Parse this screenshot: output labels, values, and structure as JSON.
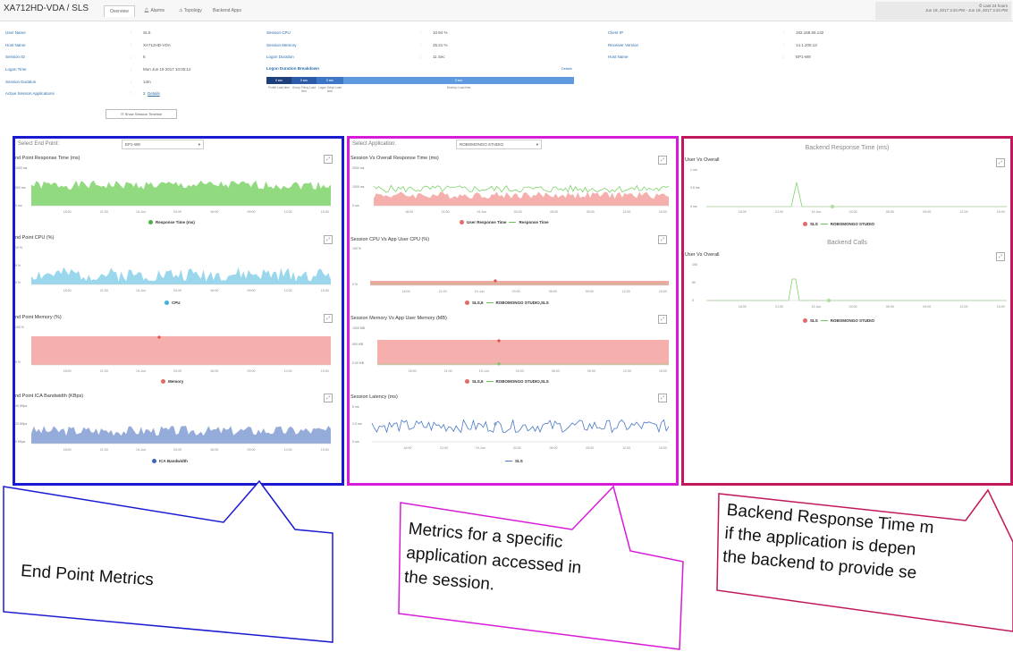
{
  "header": {
    "title": "XA712HD-VDA / SLS",
    "tabs": [
      "Overview",
      "Alarms",
      "Topology",
      "Backend Apps"
    ],
    "range_label": "Last 24 hours",
    "range_detail": "Jun 18, 2017 3:34 PM - Jun 19, 2017 3:34 PM"
  },
  "summary": {
    "col1": [
      {
        "label": "User Name",
        "value": "SLS"
      },
      {
        "label": "Host Name",
        "value": "XA712HD-VDA"
      },
      {
        "label": "Session ID",
        "value": "6"
      },
      {
        "label": "Logon Time",
        "value": "Mon Jun 19 2017 10:00:12"
      },
      {
        "label": "Session Duration",
        "value": "14m"
      },
      {
        "label": "Active Session Applications",
        "value": "2",
        "link": "Details"
      }
    ],
    "col2": [
      {
        "label": "Session CPU",
        "value": "10.94 %"
      },
      {
        "label": "Session Memory",
        "value": "25.21 %"
      },
      {
        "label": "Logon Duration",
        "value": "11 Sec"
      }
    ],
    "col3": [
      {
        "label": "Client IP",
        "value": "192.168.65.132"
      },
      {
        "label": "Receiver Version",
        "value": "14.1.200.13"
      },
      {
        "label": "Host Name",
        "value": "EP1-W8"
      }
    ],
    "timeline_button": "Show Session Timeline",
    "breakdown": {
      "title": "Logon Duration Breakdown",
      "link": "Details",
      "segments": [
        {
          "value": "0 sec",
          "label": "Profile Load time"
        },
        {
          "value": "0 sec",
          "label": "Group Policy Load time"
        },
        {
          "value": "0 sec",
          "label": "Logon Script Load time"
        },
        {
          "value": "0 sec",
          "label": "Desktop Load time"
        }
      ]
    }
  },
  "left": {
    "select_label": "Select End Point:",
    "select_value": "EP1-W8",
    "charts": [
      {
        "title": "nd Point Response Time (ms)",
        "yticks": [
          "1000 ms",
          "500 ms",
          "0 ms"
        ],
        "legend": "Response Time (ms)"
      },
      {
        "title": "nd Point CPU (%)",
        "yticks": [
          "10 %",
          "5 %",
          "0 %"
        ],
        "legend": "CPU"
      },
      {
        "title": "nd Point Memory (%)",
        "yticks": [
          "100 %",
          "5 %"
        ],
        "legend": "Memory"
      },
      {
        "title": "nd Point ICA Bandwidth (KBps)",
        "yticks": [
          "40 KBps",
          "20 KBps",
          "0 KBps"
        ],
        "legend": "ICA Bandwidth"
      }
    ]
  },
  "middle": {
    "select_label": "Select Application:",
    "select_value": "ROBOMONGO STUDIO",
    "charts": [
      {
        "title": "Session Vs Overall Response Time (ms)",
        "yticks": [
          "2000 ms",
          "1000 ms",
          "0 ms"
        ],
        "legend1": "User Response Time",
        "legend2": "Response Time"
      },
      {
        "title": "Session CPU Vs App User CPU (%)",
        "yticks": [
          "100 %",
          "0 %"
        ],
        "legend1": "SLS,6",
        "legend2": "ROBOMONGO STUDIO,SLS"
      },
      {
        "title": "Session Memory Vs App User Memory (MB)",
        "yticks": [
          "1000 MB",
          "500 MB",
          "0.00 MB"
        ],
        "legend1": "SLS,6",
        "legend2": "ROBOMONGO STUDIO,SLS"
      },
      {
        "title": "Session Latency (ms)",
        "yticks": [
          "5 ms",
          "2.5 ms",
          "0 ms"
        ],
        "legend1": "SLS"
      }
    ]
  },
  "right": {
    "title1": "Backend Response Time (ms)",
    "sub1": "User Vs Overall",
    "yticks1": [
      "1 ms",
      "0.5 ms",
      "0 ms"
    ],
    "title2": "Backend Calls",
    "sub2": "User Vs Overall",
    "yticks2": [
      "100",
      "50",
      "0"
    ],
    "legend1": "SLS",
    "legend2": "ROBOMONGO STUDIO"
  },
  "xticks": [
    "18:00",
    "21:00",
    "19-Jun",
    "03:00",
    "06:00",
    "09:00",
    "12:00",
    "15:00"
  ],
  "callouts": {
    "left": [
      "End Point Metrics"
    ],
    "middle": [
      "Metrics for a specific",
      "application accessed in",
      "the session."
    ],
    "right": [
      "Backend Response Time m",
      "if the application is depen",
      "the backend to provide se"
    ]
  },
  "colors": {
    "blue_box": "#1a1ad0",
    "magenta_box": "#d81bd8",
    "crimson_box": "#c2185b",
    "green": "#7ed36a",
    "cyan": "#8fd3ea",
    "pink": "#f4a7a4",
    "lavender": "#8fa6d8",
    "latency": "#4a78c8"
  }
}
